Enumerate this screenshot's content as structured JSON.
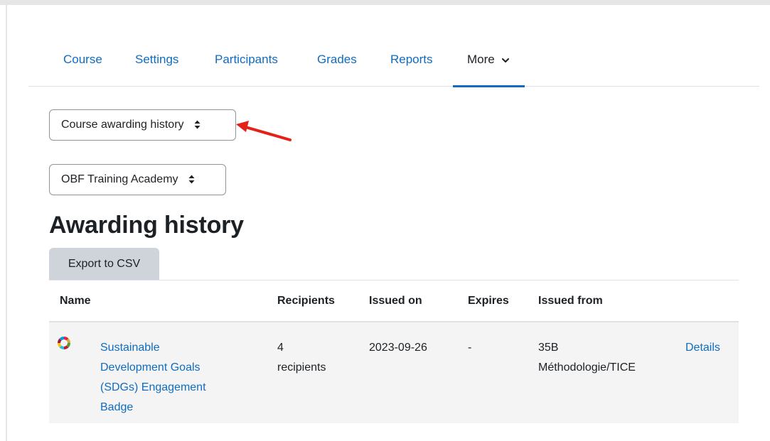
{
  "nav": {
    "items": [
      {
        "label": "Course"
      },
      {
        "label": "Settings"
      },
      {
        "label": "Participants"
      },
      {
        "label": "Grades"
      },
      {
        "label": "Reports"
      },
      {
        "label": "More"
      }
    ]
  },
  "selects": {
    "view": "Course awarding history",
    "issuer": "OBF Training Academy"
  },
  "page": {
    "title": "Awarding history",
    "export_label": "Export to CSV"
  },
  "table": {
    "headers": {
      "name": "Name",
      "recipients": "Recipients",
      "issued_on": "Issued on",
      "expires": "Expires",
      "issued_from": "Issued from"
    },
    "rows": [
      {
        "name_lines": [
          "Sustainable",
          "Development Goals",
          "(SDGs) Engagement",
          "Badge"
        ],
        "recipients_lines": [
          "4",
          "recipients"
        ],
        "issued_on": "2023-09-26",
        "expires": "-",
        "issued_from_lines": [
          "35B",
          "Méthodologie/TICE"
        ],
        "action": "Details"
      }
    ]
  },
  "colors": {
    "link": "#0f6cbf",
    "annotation_arrow": "#e32119",
    "row_bg": "#f4f4f4",
    "export_bg": "#ced4da"
  }
}
